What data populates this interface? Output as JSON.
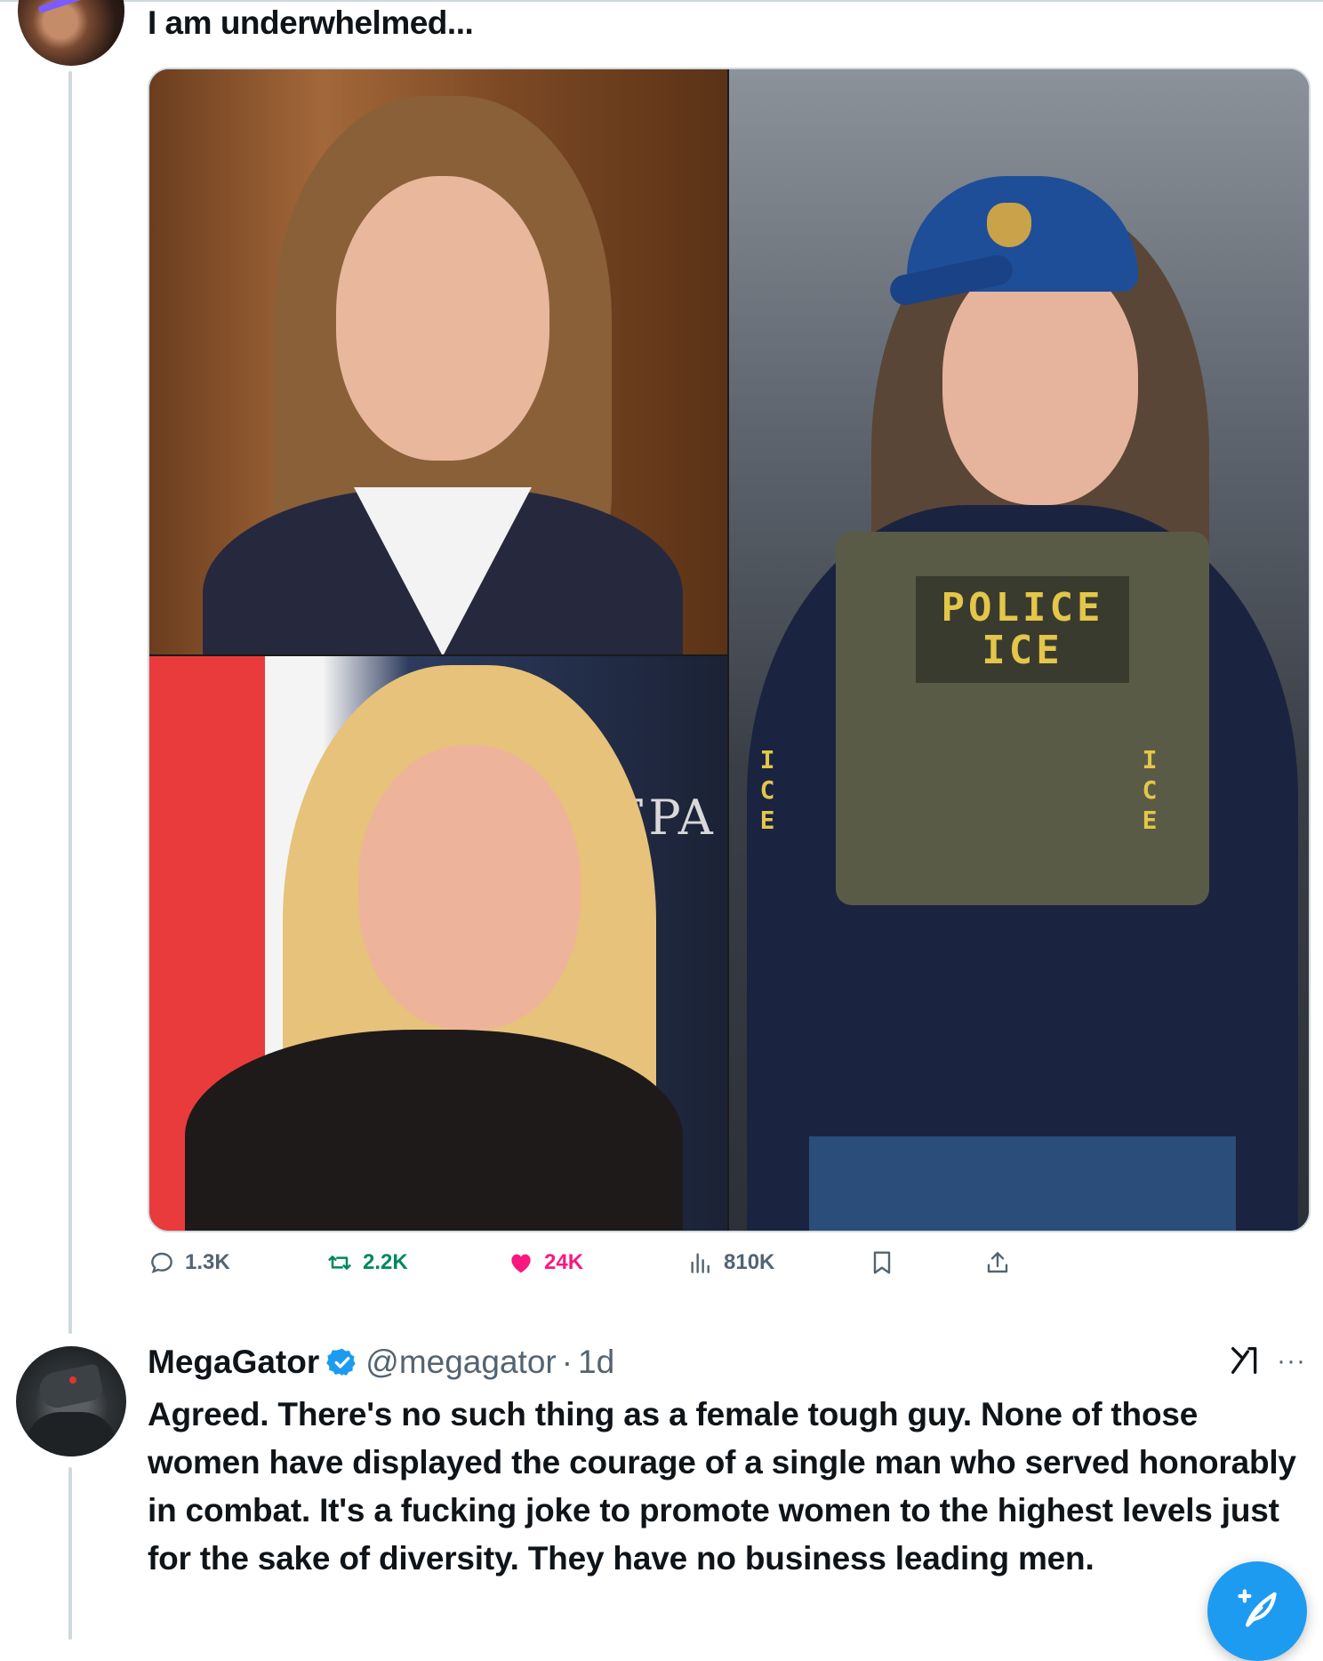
{
  "top_post": {
    "text": "I am underwhelmed...",
    "media": {
      "images": [
        {
          "name": "portrait-woman-judicial-robe"
        },
        {
          "name": "portrait-woman-podium"
        },
        {
          "name": "portrait-woman-ice-vest"
        }
      ],
      "photo_sign_text": "EPA",
      "vest_text": "POLICE\nICE",
      "vest_side_labels": [
        "I\nC\nE",
        "I\nC\nE"
      ]
    },
    "stats": {
      "replies": "1.3K",
      "retweets": "2.2K",
      "likes": "24K",
      "views": "810K"
    }
  },
  "reply_post": {
    "display_name": "MegaGator",
    "handle": "@megagator",
    "separator": "·",
    "time": "1d",
    "more": "···",
    "body": "Agreed. There's no such thing as a female tough guy. None of those women have displayed the courage of a single man who served honorably in combat. It's a fucking joke to promote women to the highest levels just for the sake of diversity. They have no business leading men."
  },
  "colors": {
    "text_primary": "#0f1419",
    "text_secondary": "#536471",
    "retweet": "#00875f",
    "like": "#f91880",
    "accent": "#1d9bf0",
    "thread_line": "#cfd9de"
  },
  "icons": [
    "reply-icon",
    "retweet-icon",
    "like-icon",
    "views-icon",
    "bookmark-icon",
    "share-icon",
    "verified-badge-icon",
    "grok-icon",
    "more-icon",
    "compose-icon"
  ]
}
